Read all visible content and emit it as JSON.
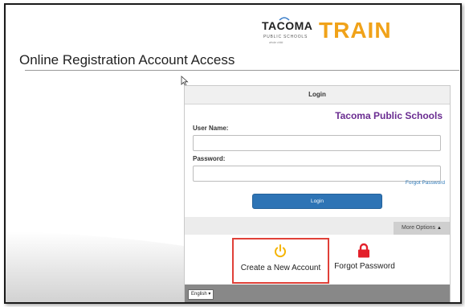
{
  "logo": {
    "district_name": "TACOMA",
    "district_sub": "PUBLIC SCHOOLS",
    "district_tag": "whole child",
    "app_name": "TRAIN"
  },
  "page": {
    "title": "Online Registration Account Access"
  },
  "login": {
    "header": "Login",
    "district": "Tacoma Public Schools",
    "username_label": "User Name:",
    "username_value": "",
    "password_label": "Password:",
    "password_value": "",
    "forgot_password_link": "Forgot Password",
    "login_button": "Login",
    "more_options": "More Options"
  },
  "options": {
    "create_account": "Create a New Account",
    "forgot_password": "Forgot Password"
  },
  "footer": {
    "language": "English"
  },
  "colors": {
    "accent_orange": "#f0a219",
    "district_purple": "#6a2c91",
    "link_blue": "#2e79b8",
    "button_blue": "#2e74b5",
    "highlight_red": "#e04038",
    "power_icon_yellow": "#f5b400",
    "lock_icon_red": "#e3202a"
  },
  "icons": {
    "create_account_icon": "power-icon",
    "forgot_password_icon": "lock-icon",
    "more_options_icon": "caret-up-icon",
    "language_icon": "caret-down-icon"
  }
}
